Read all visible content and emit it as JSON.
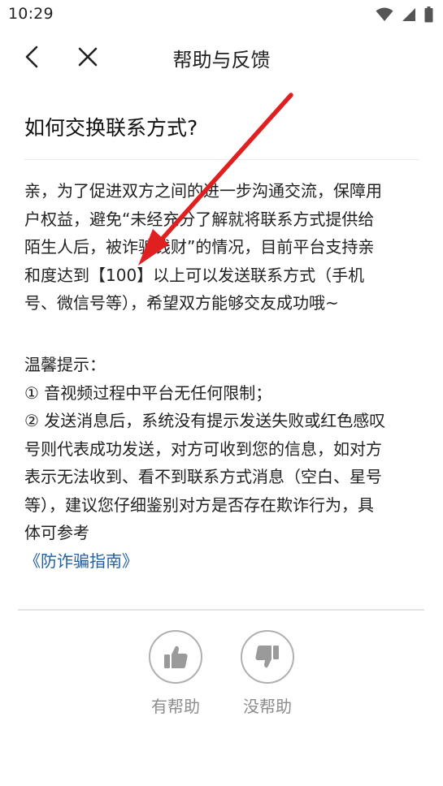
{
  "status_bar": {
    "time": "10:29",
    "icons": [
      "wifi-icon",
      "signal-icon",
      "battery-icon"
    ]
  },
  "toolbar": {
    "back_icon": "chevron-left-icon",
    "close_icon": "close-icon",
    "title": "帮助与反馈"
  },
  "question": "如何交换联系方式?",
  "answer_lines": [
    "亲，为了促进双方之间的进一步沟通交流，保障用",
    "户权益，避免“未经充分了解就将联系方式提供给",
    "陌生人后，被诈骗钱财”的情况，目前平台支持亲",
    "和度达到【100】以上可以发送联系方式（手机",
    "号、微信号等），希望双方能够交友成功哦~"
  ],
  "tips": {
    "heading": "温馨提示：",
    "item1": "① 音视频过程中平台无任何限制；",
    "item2_lines": [
      "② 发送消息后，系统没有提示发送失败或红色感叹",
      "号则代表成功发送，对方可收到您的信息，如对方",
      "表示无法收到、看不到联系方式消息（空白、星号",
      "等），建议您仔细鉴别对方是否存在欺诈行为，具",
      "体可参考"
    ],
    "link_label": "《防诈骗指南》"
  },
  "feedback": {
    "helpful_label": "有帮助",
    "not_helpful_label": "没帮助",
    "helpful_icon": "thumbs-up-icon",
    "not_helpful_icon": "thumbs-down-icon"
  },
  "colors": {
    "link": "#1e5fa6",
    "annotation_arrow": "#e02020",
    "muted": "#8c8c8c"
  }
}
